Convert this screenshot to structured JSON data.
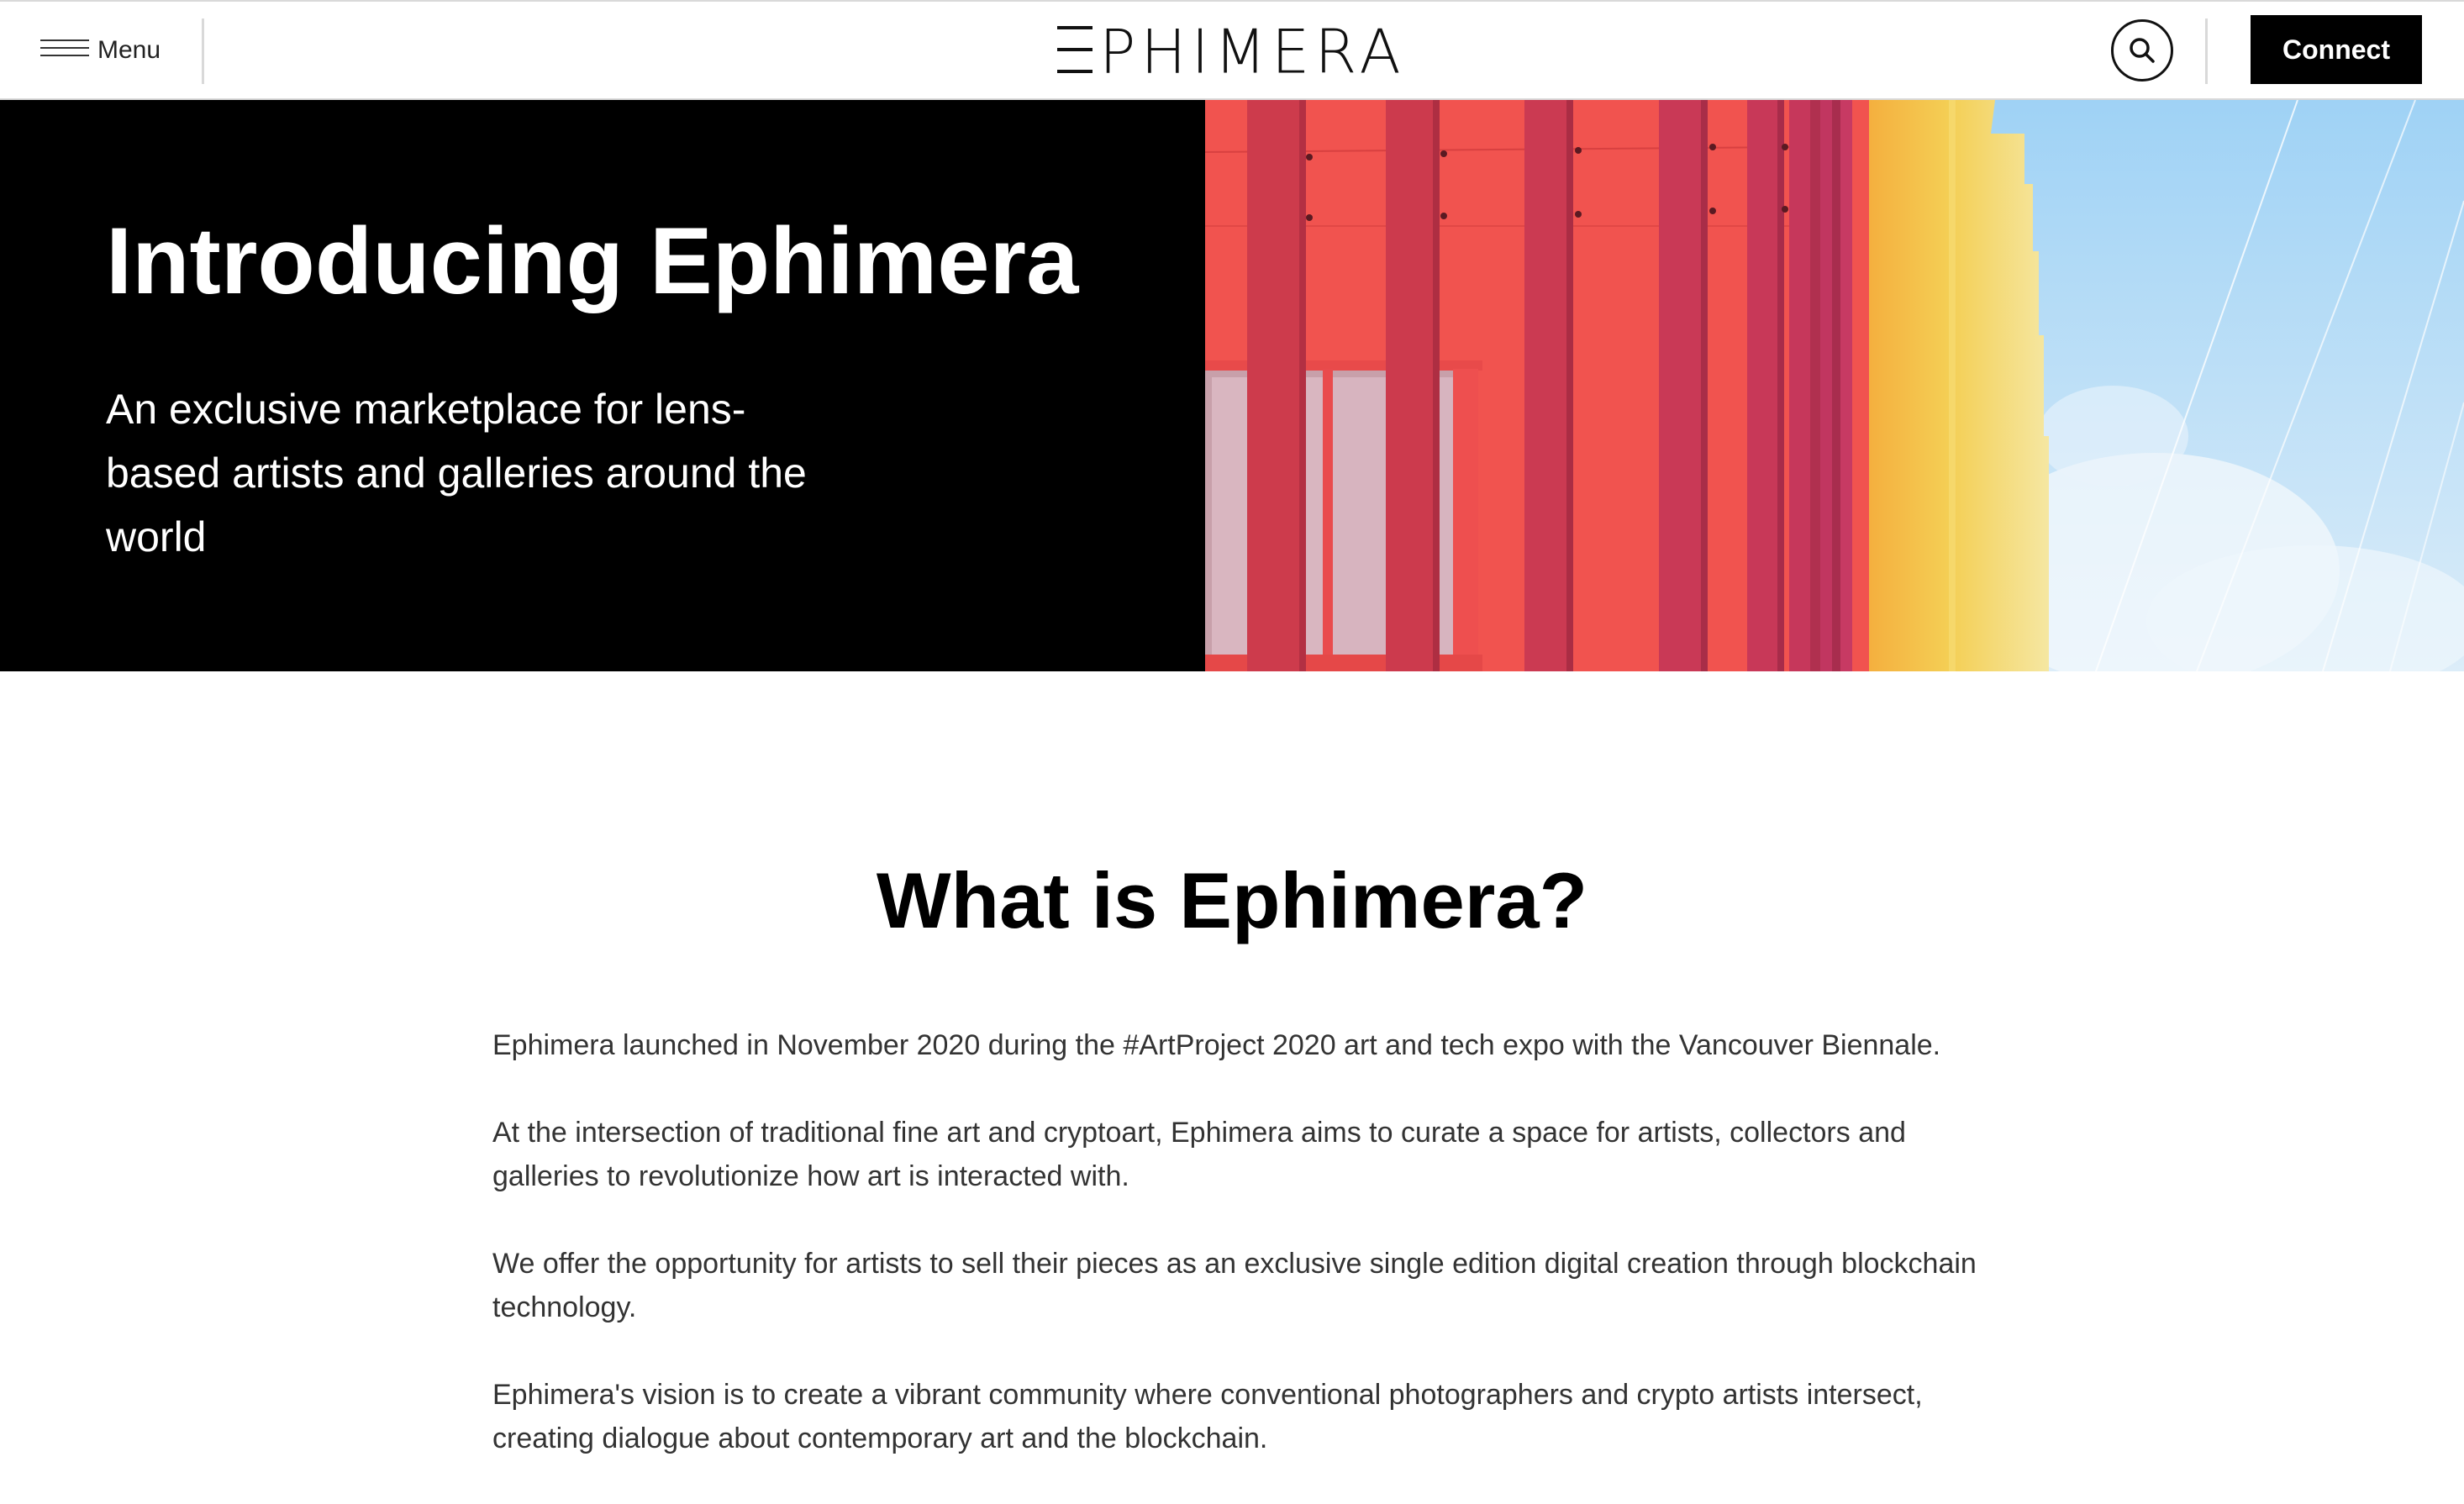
{
  "header": {
    "menu_label": "Menu",
    "logo_text": "PHIMERA",
    "search_icon": "search-icon",
    "connect_label": "Connect"
  },
  "hero": {
    "title": "Introducing Ephimera",
    "subtitle": "An exclusive marketplace for lens-based artists and galleries around the world"
  },
  "about": {
    "heading": "What is Ephimera?",
    "paragraphs": [
      "Ephimera launched in November 2020 during the #ArtProject 2020 art and tech expo with the Vancouver Biennale.",
      "At the intersection of traditional fine art and cryptoart, Ephimera aims to curate a space for artists, collectors and galleries to revolutionize how art is interacted with.",
      "We offer the opportunity for artists to sell their pieces as an exclusive single edition digital creation through blockchain technology.",
      "Ephimera's vision is to create a vibrant community where conventional photographers and crypto artists intersect, creating dialogue about contemporary art and the blockchain."
    ]
  },
  "colors": {
    "black": "#000000",
    "red_facade": "#f0504e",
    "crimson_fins": "#c83a55",
    "yellow": "#f2c64a",
    "sky": "#bfe0f7"
  }
}
